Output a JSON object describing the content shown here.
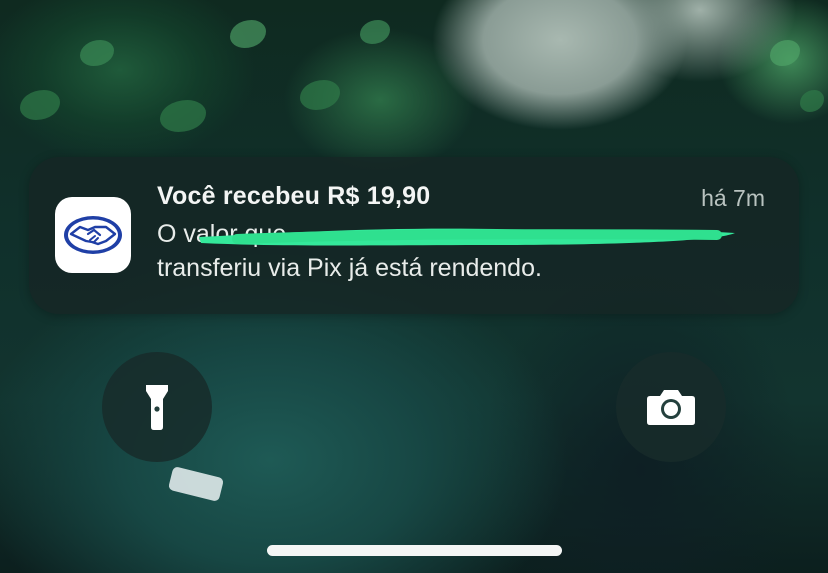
{
  "notification": {
    "app_icon": "mercado-pago-handshake-icon",
    "title": "Você recebeu R$ 19,90",
    "time": "há 7m",
    "body_line1": "O valor que",
    "body_line2": "transferiu via Pix já está rendendo."
  },
  "quick_actions": {
    "flashlight_icon": "flashlight-icon",
    "camera_icon": "camera-icon"
  },
  "colors": {
    "redaction": "#34e89a",
    "icon_blue": "#1f3fa6"
  }
}
